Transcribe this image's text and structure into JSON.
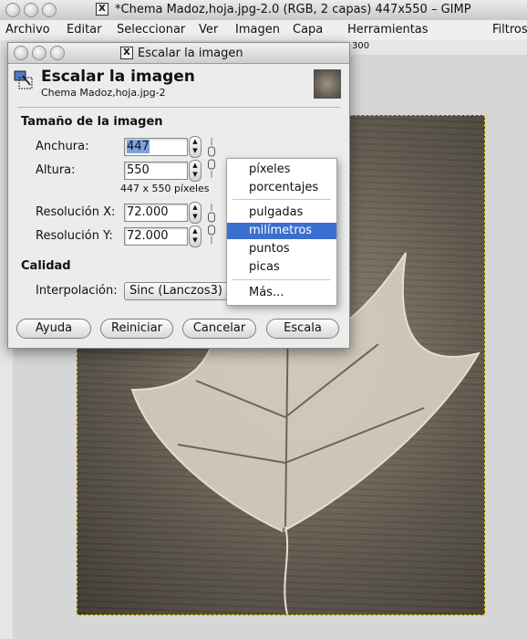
{
  "window": {
    "title": "*Chema Madoz,hoja.jpg-2.0 (RGB, 2 capas) 447x550 – GIMP",
    "x_icon": "X"
  },
  "menubar": [
    "Archivo",
    "Editar",
    "Seleccionar",
    "Ver",
    "Imagen",
    "Capa",
    "Herramientas",
    "Filtros"
  ],
  "ruler": {
    "top_mark": "300"
  },
  "dialog": {
    "title": "Escalar la imagen",
    "x_icon": "X",
    "header_title": "Escalar la imagen",
    "header_subtitle": "Chema Madoz,hoja.jpg-2",
    "section_size": "Tamaño de la imagen",
    "width_label": "Anchura:",
    "width_value": "447",
    "height_label": "Altura:",
    "height_value": "550",
    "dimension_hint": "447 x 550 píxeles",
    "res_x_label": "Resolución X:",
    "res_x_value": "72.000",
    "res_y_label": "Resolución Y:",
    "res_y_value": "72.000",
    "section_quality": "Calidad",
    "interp_label": "Interpolación:",
    "interp_value": "Sinc (Lanczos3)",
    "buttons": {
      "help": "Ayuda",
      "reset": "Reiniciar",
      "cancel": "Cancelar",
      "scale": "Escala"
    }
  },
  "dropdown": {
    "items": [
      "píxeles",
      "porcentajes",
      "pulgadas",
      "milímetros",
      "puntos",
      "picas",
      "Más..."
    ],
    "selected": "milímetros"
  },
  "icons": [
    "x-icon",
    "chain-link-icon",
    "spin-arrows-icon",
    "scale-tool-icon"
  ],
  "colors": {
    "selection": "#3b6fcf",
    "marching_ants": "#d6c000"
  }
}
